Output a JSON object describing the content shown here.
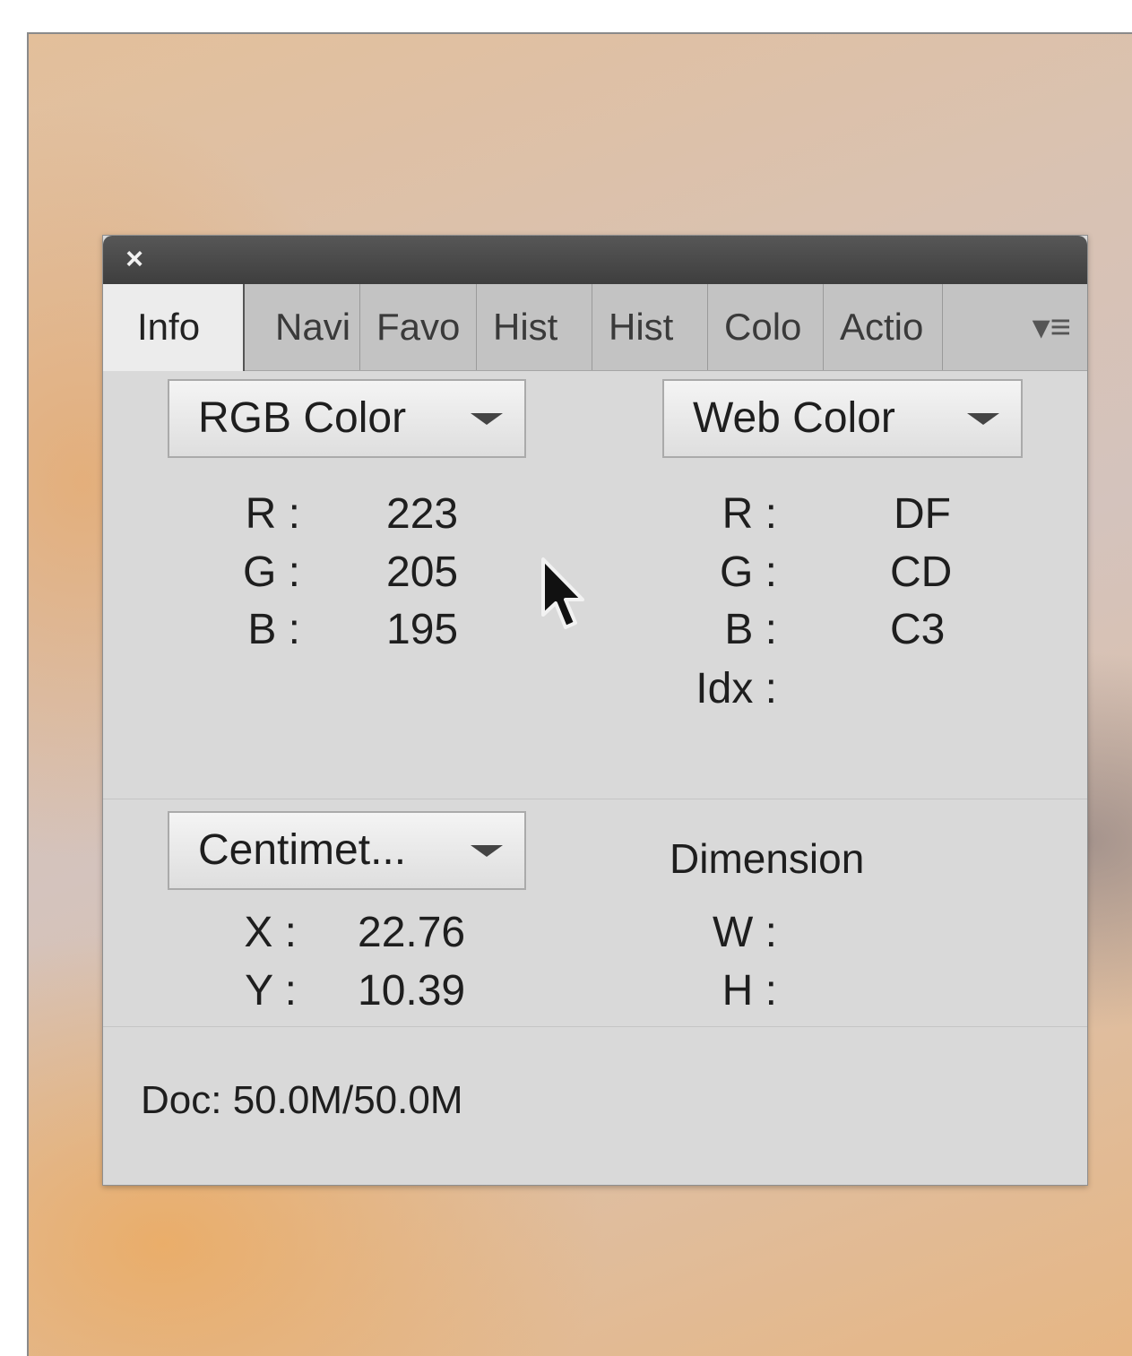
{
  "panel": {
    "tabs": [
      "Info",
      "Navi",
      "Favo",
      "Hist",
      "Hist",
      "Colo",
      "Actio"
    ],
    "menu_icon": "panel-menu-icon",
    "close_icon": "close-icon",
    "close_glyph": "×",
    "menu_glyph": "▾≡"
  },
  "color1": {
    "mode": "RGB Color",
    "labels": [
      "R :",
      "G :",
      "B :"
    ],
    "values": [
      "223",
      "205",
      "195"
    ]
  },
  "color2": {
    "mode": "Web Color",
    "labels": [
      "R :",
      "G :",
      "B :",
      "Idx :"
    ],
    "values": [
      "DF",
      "CD",
      "C3",
      ""
    ]
  },
  "position": {
    "unit": "Centimet...",
    "labels": [
      "X :",
      "Y :"
    ],
    "values": [
      "22.76",
      "10.39"
    ]
  },
  "dimension": {
    "title": "Dimension",
    "labels": [
      "W :",
      "H :"
    ],
    "values": [
      "",
      ""
    ]
  },
  "status": {
    "doc": "Doc: 50.0M/50.0M"
  }
}
